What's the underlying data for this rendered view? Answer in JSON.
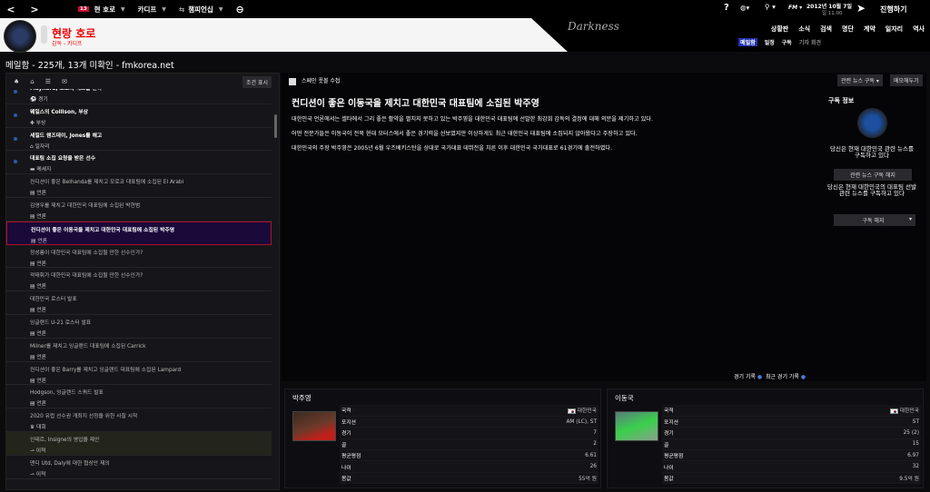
{
  "topbar": {
    "club": "현 호로",
    "badge": "13",
    "team": "카디프",
    "competition": "챔피언십",
    "date": "2012년 10월 7일",
    "time": "일 11:00",
    "continue": "진행하기",
    "fm": "FM"
  },
  "header": {
    "manager": "현랑 호로",
    "subtitle": "감독 - 카디프",
    "logo_text": "Darkness",
    "nav": [
      "상황판",
      "소식",
      "검색",
      "명단",
      "계약",
      "일자리",
      "역사"
    ],
    "active_nav": "소식",
    "subnav": [
      "메일함",
      "일정",
      "구독",
      "기자 회견"
    ],
    "active_subnav": "메일함"
  },
  "page_title": "메일함 - 225개, 13개 미확인 - fmkorea.net",
  "inbox": {
    "filter_label": "조건 표시",
    "items": [
      {
        "title": "Maynard, 포포의 레드를 받아",
        "category": "경기",
        "unread": true
      },
      {
        "title": "웨일스의 Collison, 부상",
        "category": "부상",
        "unread": true
      },
      {
        "title": "세필드 웬즈데이, Jones를 해고",
        "category": "일자리",
        "unread": true
      },
      {
        "title": "대표팀 소집 요청을 받은 선수",
        "category": "메세지",
        "unread": true
      },
      {
        "title": "컨디션이 좋은 Belhanda를 제치고 모로코 대표팀에 소집된 El Arabi",
        "category": "언론"
      },
      {
        "title": "김영우를 제치고 대한민국 대표팀에 소집된 박현범",
        "category": "언론"
      },
      {
        "title": "컨디션이 좋은 이동국을 제치고 대한민국 대표팀에 소집된 박주영",
        "category": "언론",
        "selected": true
      },
      {
        "title": "정성룡이 대한민국 대표팀에 소집될 만한 선수인가?",
        "category": "언론"
      },
      {
        "title": "곽태휘가 대한민국 대표팀에 소집될 만한 선수인가?",
        "category": "언론"
      },
      {
        "title": "대한민국 로스터 발표",
        "category": "언론"
      },
      {
        "title": "잉글랜드 U-21 로스터 발표",
        "category": "언론"
      },
      {
        "title": "Milner를 제치고 잉글랜드 대표팀에 소집된 Carrick",
        "category": "언론"
      },
      {
        "title": "컨디션이 좋은 Barry를 제치고 잉글랜드 대표팀에 소집된 Lampard",
        "category": "언론"
      },
      {
        "title": "Hodgson, 잉글랜드 스쿼드 발표",
        "category": "언론"
      },
      {
        "title": "2020 유럽 선수권 개최지 선정을 위한 사찰 시작",
        "category": "대회"
      },
      {
        "title": "인테르, Insigne의 영입을 제안",
        "category": "이적",
        "highlight": true
      },
      {
        "title": "맨디 Utd, Daly에 대한 협상안 제의",
        "category": "이적"
      }
    ]
  },
  "article": {
    "category": "스페인 풋볼 수첩",
    "title": "컨디션이 좋은 이동국을 제치고 대한민국 대표팀에 소집된 박주영",
    "paragraphs": [
      "대한민국 언론에서는 셀타에서 그리 좋은 활약을 펼치지 못하고 있는 박주영을 대한민국 대표팀에 선발한 최강희 감독의 결정에 대해 의문을 제기하고 있다.",
      "어떤 전문가들은 이동국이 전북 현대 모터스에서 좋은 경기력을 선보였지만 이상하게도 최근 대한민국 대표팀에 소집되지 않아왔다고 주장하고 있다.",
      "대한민국의 주장 박주영은 2005년 6월 우즈베키스탄을 상대로 국가대표 데뷔전을 치른 이후 대한민국 국가대표로 61경기에 출전하였다."
    ],
    "related_btn": "관련 뉴스 구독",
    "memo_btn": "메모해두기",
    "stats_link": "경기 기록",
    "recent_link": "최근 경기 기록"
  },
  "subscription": {
    "heading": "구독 정보",
    "msg1": "당신은 현재 대한민국 관련 뉴스를 구독하고 있다",
    "btn1": "관련 뉴스 구독 해지",
    "msg2": "당신은 현재 대한민국의 대표팀 선발 관련 뉴스를 구독하고 있다",
    "btn2": "구독 해지"
  },
  "players": [
    {
      "name": "박주영",
      "rows": [
        [
          "국적",
          "대한민국"
        ],
        [
          "포지션",
          "AM (LC), ST"
        ],
        [
          "경기",
          "7"
        ],
        [
          "골",
          "2"
        ],
        [
          "평균평점",
          "6.61"
        ],
        [
          "나이",
          "26"
        ],
        [
          "몸값",
          "55억 원"
        ]
      ]
    },
    {
      "name": "이동국",
      "rows": [
        [
          "국적",
          "대한민국"
        ],
        [
          "포지션",
          "ST"
        ],
        [
          "경기",
          "25 (2)"
        ],
        [
          "골",
          "15"
        ],
        [
          "평균평점",
          "6.97"
        ],
        [
          "나이",
          "32"
        ],
        [
          "몸값",
          "9.5억 원"
        ]
      ]
    }
  ]
}
